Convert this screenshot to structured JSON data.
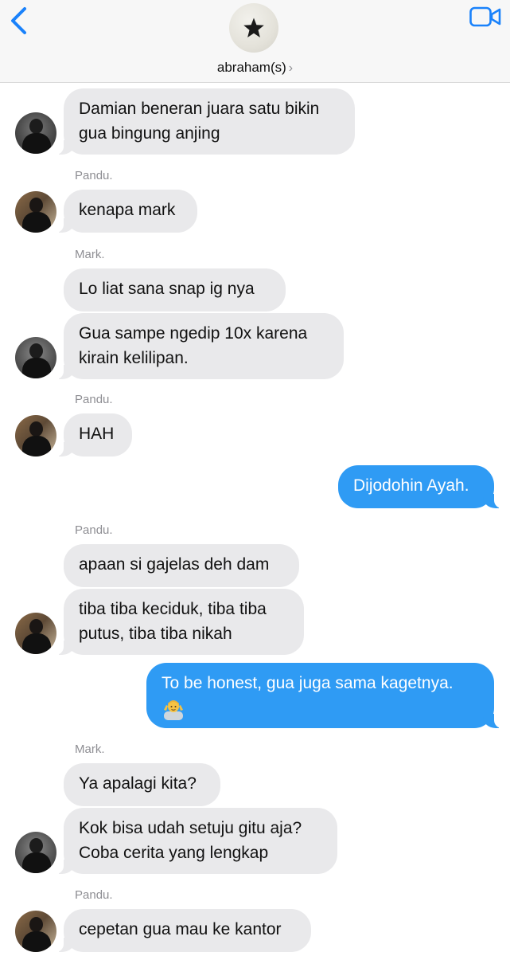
{
  "header": {
    "group_name": "abraham(s)",
    "chevron": "›",
    "back_icon": "chevron-left-icon",
    "video_icon": "video-camera-icon",
    "avatar_icon": "star-icon"
  },
  "colors": {
    "incoming_bubble": "#e9e9eb",
    "outgoing_bubble": "#2f9bf4",
    "accent": "#1a82fb",
    "sender_label": "#8e8e93"
  },
  "messages": [
    {
      "text_lines": [
        "Damian beneran juara satu bikin",
        "gua bingung anjing"
      ]
    },
    {
      "sender": "Pandu.",
      "text": "kenapa mark"
    },
    {
      "sender": "Mark.",
      "text": "Lo liat sana snap ig nya"
    },
    {
      "text_lines": [
        "Gua sampe ngedip 10x karena",
        "kirain kelilipan."
      ]
    },
    {
      "sender": "Pandu.",
      "text": "HAH"
    },
    {
      "text": "Dijodohin Ayah."
    },
    {
      "sender": "Pandu.",
      "text": "apaan si gajelas deh dam"
    },
    {
      "text_lines": [
        "tiba tiba keciduk, tiba tiba",
        "putus, tiba tiba nikah"
      ]
    },
    {
      "text": "To be honest, gua juga sama kagetnya.",
      "emoji": "person-shrugging-emoji"
    },
    {
      "sender": "Mark.",
      "text": "Ya apalagi kita?"
    },
    {
      "text_lines": [
        "Kok bisa udah setuju gitu aja?",
        "Coba cerita yang lengkap"
      ]
    },
    {
      "sender": "Pandu.",
      "text": "cepetan gua mau ke kantor"
    }
  ]
}
